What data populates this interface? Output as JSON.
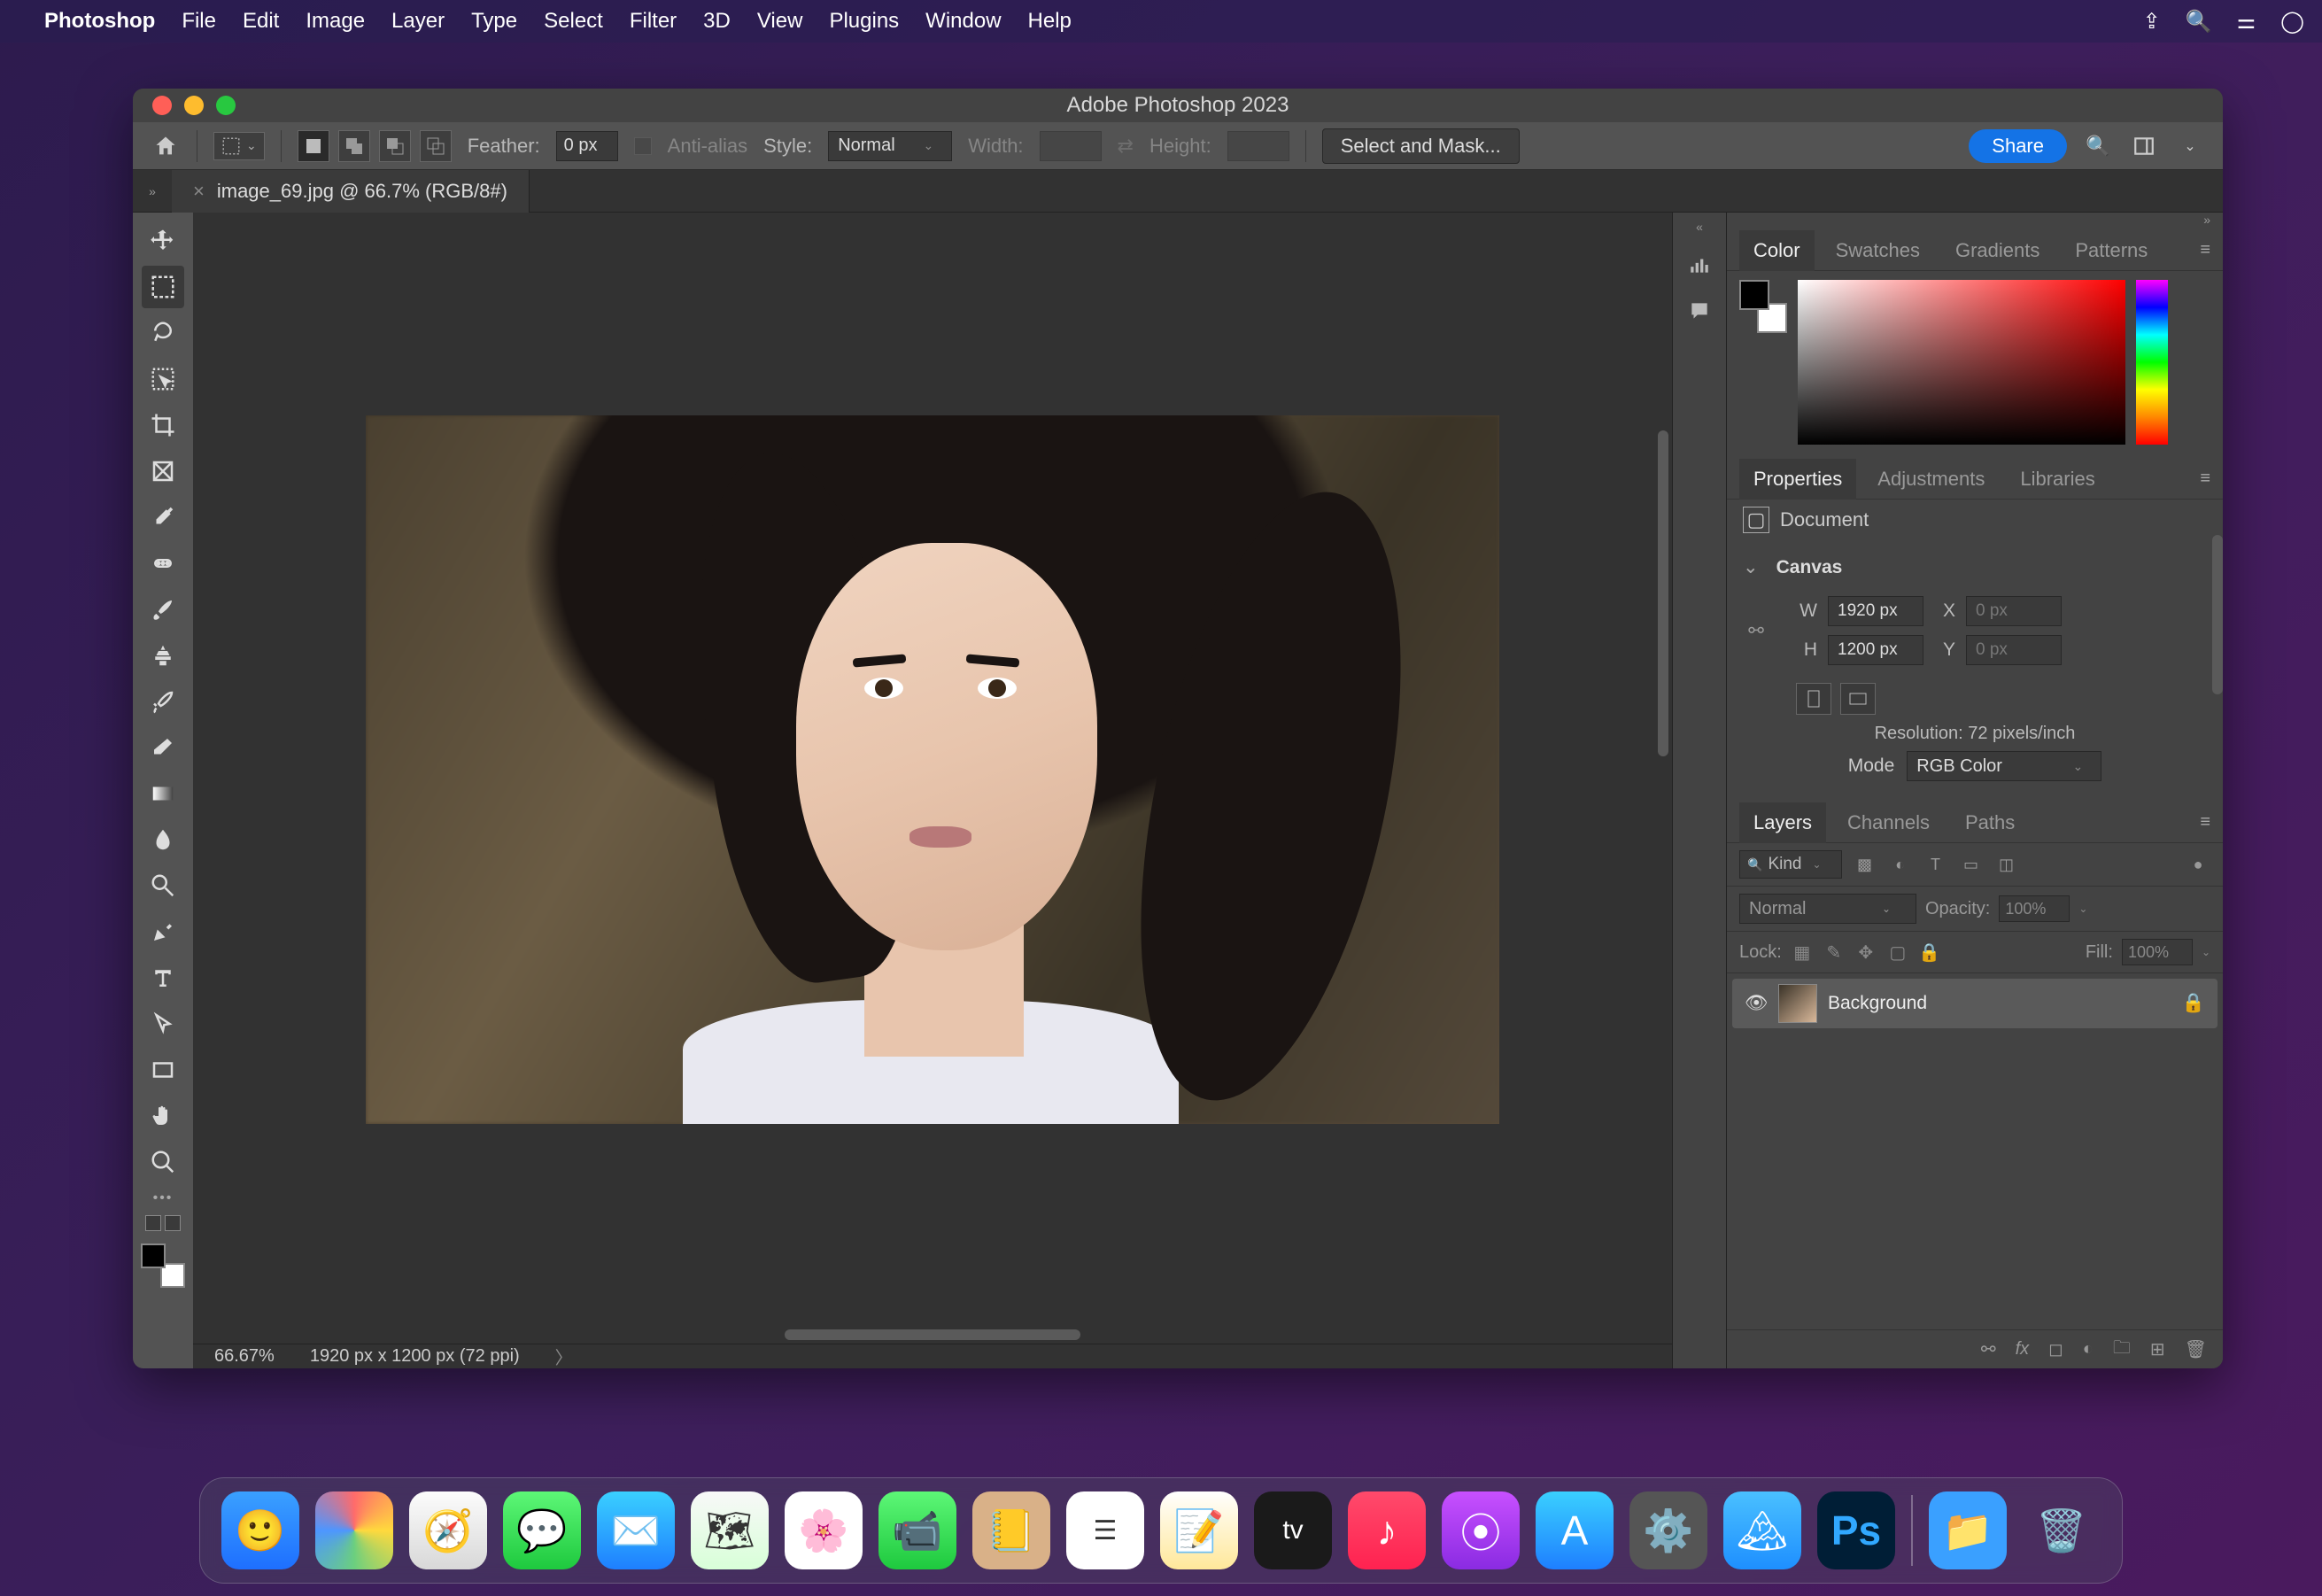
{
  "os_menubar": {
    "app_name": "Photoshop",
    "items": [
      "File",
      "Edit",
      "Image",
      "Layer",
      "Type",
      "Select",
      "Filter",
      "3D",
      "View",
      "Plugins",
      "Window",
      "Help"
    ]
  },
  "window": {
    "title": "Adobe Photoshop 2023"
  },
  "options_bar": {
    "feather_label": "Feather:",
    "feather_value": "0 px",
    "antialias_label": "Anti-alias",
    "style_label": "Style:",
    "style_value": "Normal",
    "width_label": "Width:",
    "width_value": "",
    "height_label": "Height:",
    "height_value": "",
    "select_mask": "Select and Mask...",
    "share": "Share"
  },
  "document_tab": {
    "title": "image_69.jpg @ 66.7% (RGB/8#)"
  },
  "status_bar": {
    "zoom": "66.67%",
    "doc_info": "1920 px x 1200 px (72 ppi)"
  },
  "panels": {
    "color": {
      "tabs": [
        "Color",
        "Swatches",
        "Gradients",
        "Patterns"
      ],
      "active": "Color"
    },
    "props": {
      "tabs": [
        "Properties",
        "Adjustments",
        "Libraries"
      ],
      "active": "Properties",
      "doc_label": "Document",
      "canvas_label": "Canvas",
      "w_label": "W",
      "w_value": "1920 px",
      "h_label": "H",
      "h_value": "1200 px",
      "x_label": "X",
      "x_value": "0 px",
      "y_label": "Y",
      "y_value": "0 px",
      "resolution": "Resolution: 72 pixels/inch",
      "mode_label": "Mode",
      "mode_value": "RGB Color"
    },
    "layers": {
      "tabs": [
        "Layers",
        "Channels",
        "Paths"
      ],
      "active": "Layers",
      "kind_label": "Kind",
      "blend_value": "Normal",
      "opacity_label": "Opacity:",
      "opacity_value": "100%",
      "lock_label": "Lock:",
      "fill_label": "Fill:",
      "fill_value": "100%",
      "layer_name": "Background"
    }
  },
  "tools": [
    "move",
    "marquee",
    "lasso",
    "object-select",
    "crop",
    "frame",
    "eyedropper",
    "heal",
    "brush",
    "stamp",
    "history-brush",
    "eraser",
    "gradient",
    "blur",
    "dodge",
    "pen",
    "type",
    "path-select",
    "rectangle",
    "hand",
    "zoom"
  ],
  "dock": [
    "Finder",
    "Launchpad",
    "Safari",
    "Messages",
    "Mail",
    "Maps",
    "Photos",
    "FaceTime",
    "Contacts",
    "Reminders",
    "Notes",
    "TV",
    "Music",
    "Podcasts",
    "App Store",
    "System Settings",
    "Pictograph",
    "Photoshop",
    "Downloads",
    "Trash"
  ]
}
